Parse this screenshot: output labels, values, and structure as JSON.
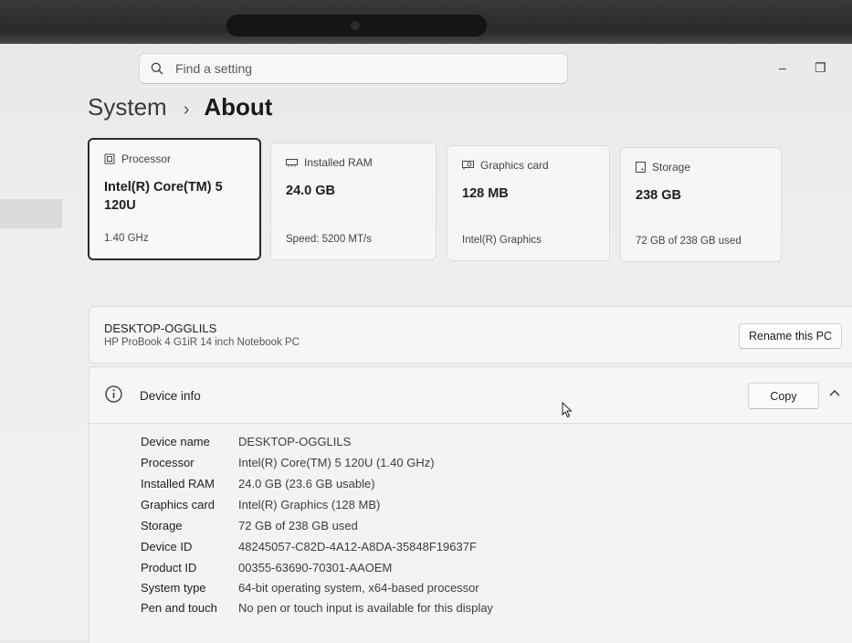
{
  "search": {
    "placeholder": "Find a setting"
  },
  "breadcrumb": {
    "parent": "System",
    "separator": "›",
    "current": "About"
  },
  "window_controls": {
    "minimize": "–",
    "restore": "❐"
  },
  "cards": [
    {
      "icon": "processor-icon",
      "label": "Processor",
      "value": "Intel(R) Core(TM) 5 120U",
      "sub": "1.40 GHz",
      "selected": true
    },
    {
      "icon": "ram-icon",
      "label": "Installed RAM",
      "value": "24.0 GB",
      "sub": "Speed: 5200 MT/s",
      "selected": false
    },
    {
      "icon": "graphics-card-icon",
      "label": "Graphics card",
      "value": "128 MB",
      "sub": "Intel(R) Graphics",
      "selected": false
    },
    {
      "icon": "storage-icon",
      "label": "Storage",
      "value": "238 GB",
      "sub": "72 GB of 238 GB used",
      "selected": false
    }
  ],
  "pc": {
    "name": "DESKTOP-OGGLILS",
    "model": "HP ProBook 4 G1iR 14 inch Notebook PC",
    "rename_label": "Rename this PC"
  },
  "device_info": {
    "title": "Device info",
    "copy_label": "Copy",
    "rows": [
      {
        "key": "Device name",
        "value": "DESKTOP-OGGLILS"
      },
      {
        "key": "Processor",
        "value": "Intel(R) Core(TM) 5 120U (1.40 GHz)"
      },
      {
        "key": "Installed RAM",
        "value": "24.0 GB (23.6 GB usable)"
      },
      {
        "key": "Graphics card",
        "value": "Intel(R) Graphics (128 MB)"
      },
      {
        "key": "Storage",
        "value": "72 GB of 238 GB used"
      },
      {
        "key": "Device ID",
        "value": "48245057-C82D-4A12-A8DA-35848F19637F"
      },
      {
        "key": "Product ID",
        "value": "00355-63690-70301-AAOEM"
      },
      {
        "key": "System type",
        "value": "64-bit operating system, x64-based processor"
      },
      {
        "key": "Pen and touch",
        "value": "No pen or touch input is available for this display"
      }
    ]
  },
  "colors": {
    "accent_border": "#2a2a2a",
    "card_bg": "#f6f6f5",
    "page_bg": "#efeeec"
  }
}
